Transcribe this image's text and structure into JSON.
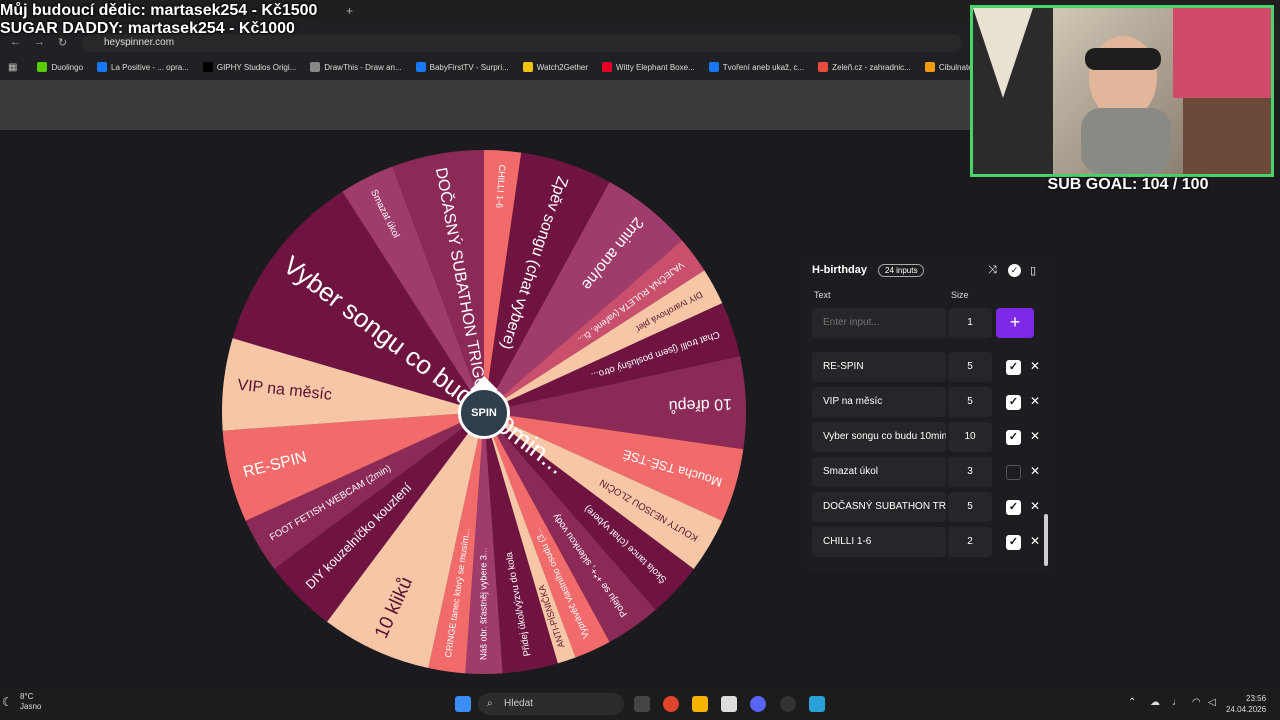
{
  "overlay": {
    "line1": "Můj budoucí dědic: martasek254 - Kč1500",
    "line2": "SUGAR DADDY: martasek254 - Kč1000",
    "sub_goal": "SUB GOAL: 104 / 100"
  },
  "browser": {
    "url": "heyspinner.com",
    "new_tab": "+",
    "bookmarks": [
      {
        "label": "Duolingo",
        "color": "#58cc02"
      },
      {
        "label": "La Positive - ... opra...",
        "color": "#1877f2"
      },
      {
        "label": "GIPHY Studios Origi...",
        "color": "#000000"
      },
      {
        "label": "DrawThis - Draw an...",
        "color": "#888888"
      },
      {
        "label": "BabyFirstTV - Surpri...",
        "color": "#1877f2"
      },
      {
        "label": "Watch2Gether",
        "color": "#f1c40f"
      },
      {
        "label": "Witty Elephant Boxe...",
        "color": "#e60023"
      },
      {
        "label": "Tvoření aneb ukaž, c...",
        "color": "#1877f2"
      },
      {
        "label": "Zeleň.cz - zahradnic...",
        "color": "#e74c3c"
      },
      {
        "label": "Cibulnaté a hlíznaté...",
        "color": "#f39c12"
      }
    ]
  },
  "wheel": {
    "spin_label": "SPIN",
    "colors": {
      "dark": "#6f1440",
      "mid": "#8c2a57",
      "plum": "#a03c6b",
      "coral": "#f26b6b",
      "peach": "#f6c6a6",
      "rose": "#c94f6d"
    },
    "segments": [
      {
        "label": "CHILLI 1-6",
        "color": "#f26b6b",
        "size": 2
      },
      {
        "label": "Zpěv songu (chat vybere)",
        "color": "#6f1440",
        "size": 5
      },
      {
        "label": "2min ano/ne",
        "color": "#a03c6b",
        "size": 5
      },
      {
        "label": "VAJEČNÁ RULETA (vařené, či...",
        "color": "#c94f6d",
        "size": 2
      },
      {
        "label": "DIY tvarohová pleť",
        "color": "#f6c6a6",
        "size": 2
      },
      {
        "label": "Chat trollí (jsem poslušný otro...",
        "color": "#6f1440",
        "size": 3
      },
      {
        "label": "10 dřepů",
        "color": "#8c2a57",
        "size": 5
      },
      {
        "label": "Moucha TSÉ-TSÉ",
        "color": "#f26b6b",
        "size": 4
      },
      {
        "label": "KOUTY NEJSOU ZLOČIN",
        "color": "#f6c6a6",
        "size": 3
      },
      {
        "label": "Škola tance (chat vybere)",
        "color": "#6f1440",
        "size": 3
      },
      {
        "label": "Poleju se +*+, sklenkou vody",
        "color": "#8c2a57",
        "size": 3
      },
      {
        "label": "Vyprávěč vlastního osudu (3...",
        "color": "#f26b6b",
        "size": 2
      },
      {
        "label": "ANTI-PÍSNIČKA",
        "color": "#f6c6a6",
        "size": 1
      },
      {
        "label": "Přidej úkol/výzvu do kola",
        "color": "#6f1440",
        "size": 3
      },
      {
        "label": "Náš obr. šťastněj vybere 3...",
        "color": "#a03c6b",
        "size": 2
      },
      {
        "label": "CRINGE tanec který se musím...",
        "color": "#f26b6b",
        "size": 2
      },
      {
        "label": "10 kliků",
        "color": "#f6c6a6",
        "size": 6
      },
      {
        "label": "DIY kouzelníčko kouzlení",
        "color": "#6f1440",
        "size": 4
      },
      {
        "label": "FOOT FETISH WEBCAM (2min)",
        "color": "#8c2a57",
        "size": 3
      },
      {
        "label": "RE-SPIN",
        "color": "#f26b6b",
        "size": 5
      },
      {
        "label": "VIP na měsíc",
        "color": "#f6c6a6",
        "size": 5
      },
      {
        "label": "Vyber songu co budu 10min...",
        "color": "#6f1440",
        "size": 10
      },
      {
        "label": "Smazat úkol",
        "color": "#a03c6b",
        "size": 3
      },
      {
        "label": "DOČASNÝ SUBATHON TRIGG...",
        "color": "#8c2a57",
        "size": 5
      }
    ]
  },
  "panel": {
    "title": "H-birthday",
    "count_badge": "24 inputs",
    "col_text": "Text",
    "col_size": "Size",
    "placeholder": "Enter input...",
    "new_size": "1",
    "add_label": "+",
    "rows": [
      {
        "text": "RE-SPIN",
        "size": "5",
        "checked": true
      },
      {
        "text": "VIP na měsíc",
        "size": "5",
        "checked": true
      },
      {
        "text": "Vyber songu co budu 10min",
        "size": "10",
        "checked": true
      },
      {
        "text": "Smazat úkol",
        "size": "3",
        "checked": false
      },
      {
        "text": "DOČASNÝ SUBATHON TRIGG",
        "size": "5",
        "checked": true
      },
      {
        "text": "CHILLI 1-6",
        "size": "2",
        "checked": true
      }
    ]
  },
  "taskbar": {
    "weather_temp": "8°C",
    "weather_desc": "Jasno",
    "search_placeholder": "Hledat",
    "time": "23:56",
    "date": "24.04.2026"
  }
}
